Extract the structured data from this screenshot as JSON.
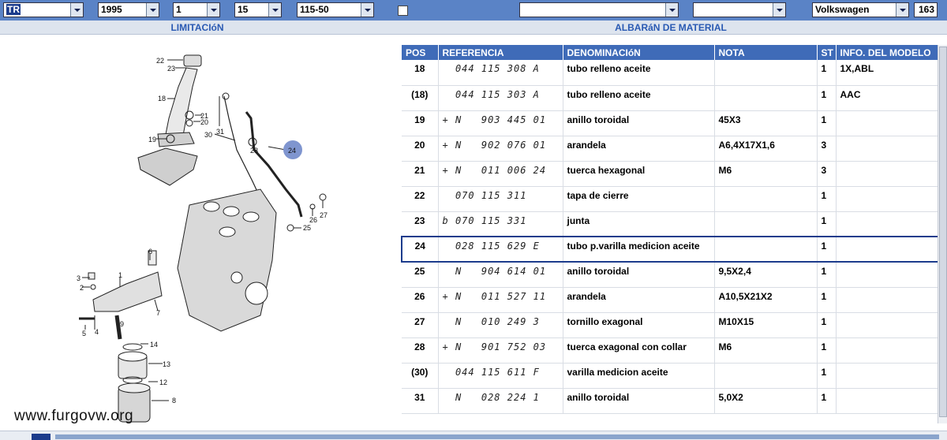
{
  "toolbar": {
    "combo1": "TR",
    "combo2": "1995",
    "combo3": "1",
    "combo4": "15",
    "combo5": "115-50",
    "combo6": "",
    "combo7": "",
    "brand": "Volkswagen",
    "counter": "163"
  },
  "sections": {
    "left_title": "LIMITACIóN",
    "right_title": "ALBARáN DE MATERIAL"
  },
  "table": {
    "headers": [
      "POS",
      "REFERENCIA",
      "DENOMINACIóN",
      "NOTA",
      "ST",
      "INFO. DEL MODELO"
    ],
    "rows": [
      {
        "pos": "18",
        "ref": "  044 115 308 A",
        "den": "tubo relleno aceite",
        "nota": "",
        "st": "1",
        "info": "1X,ABL"
      },
      {
        "pos": "(18)",
        "ref": "  044 115 303 A",
        "den": "tubo relleno aceite",
        "nota": "",
        "st": "1",
        "info": "AAC"
      },
      {
        "pos": "19",
        "ref": "+ N   903 445 01",
        "den": "anillo toroidal",
        "nota": "45X3",
        "st": "1",
        "info": ""
      },
      {
        "pos": "20",
        "ref": "+ N   902 076 01",
        "den": "arandela",
        "nota": "A6,4X17X1,6",
        "st": "3",
        "info": ""
      },
      {
        "pos": "21",
        "ref": "+ N   011 006 24",
        "den": "tuerca hexagonal",
        "nota": "M6",
        "st": "3",
        "info": ""
      },
      {
        "pos": "22",
        "ref": "  070 115 311",
        "den": "tapa de cierre",
        "nota": "",
        "st": "1",
        "info": ""
      },
      {
        "pos": "23",
        "ref": "b 070 115 331",
        "den": "junta",
        "nota": "",
        "st": "1",
        "info": ""
      },
      {
        "pos": "24",
        "ref": "  028 115 629 E",
        "den": "tubo p.varilla medicion aceite",
        "nota": "",
        "st": "1",
        "info": ""
      },
      {
        "pos": "25",
        "ref": "  N   904 614 01",
        "den": "anillo toroidal",
        "nota": "9,5X2,4",
        "st": "1",
        "info": ""
      },
      {
        "pos": "26",
        "ref": "+ N   011 527 11",
        "den": "arandela",
        "nota": "A10,5X21X2",
        "st": "1",
        "info": ""
      },
      {
        "pos": "27",
        "ref": "  N   010 249 3",
        "den": "tornillo exagonal",
        "nota": "M10X15",
        "st": "1",
        "info": ""
      },
      {
        "pos": "28",
        "ref": "+ N   901 752 03",
        "den": "tuerca exagonal con collar",
        "nota": "M6",
        "st": "1",
        "info": ""
      },
      {
        "pos": "(30)",
        "ref": "  044 115 611 F",
        "den": "varilla medicion aceite",
        "nota": "",
        "st": "1",
        "info": ""
      },
      {
        "pos": "31",
        "ref": "  N   028 224 1",
        "den": "anillo toroidal",
        "nota": "5,0X2",
        "st": "1",
        "info": ""
      }
    ],
    "active_pos": "24"
  },
  "diagram": {
    "labels": [
      "22",
      "23",
      "18",
      "21",
      "20",
      "31",
      "30",
      "19",
      "28",
      "24",
      "6",
      "1",
      "3",
      "2",
      "7",
      "26",
      "27",
      "25",
      "5",
      "4",
      "9",
      "14",
      "13",
      "12",
      "8"
    ],
    "highlight": "24"
  },
  "watermark": "www.furgovw.org",
  "colors": {
    "toolbar": "#5a83c6",
    "header_bg": "#3f6bb8",
    "section_title": "#2a5ab3",
    "highlight_circle": "#7f95cf"
  }
}
